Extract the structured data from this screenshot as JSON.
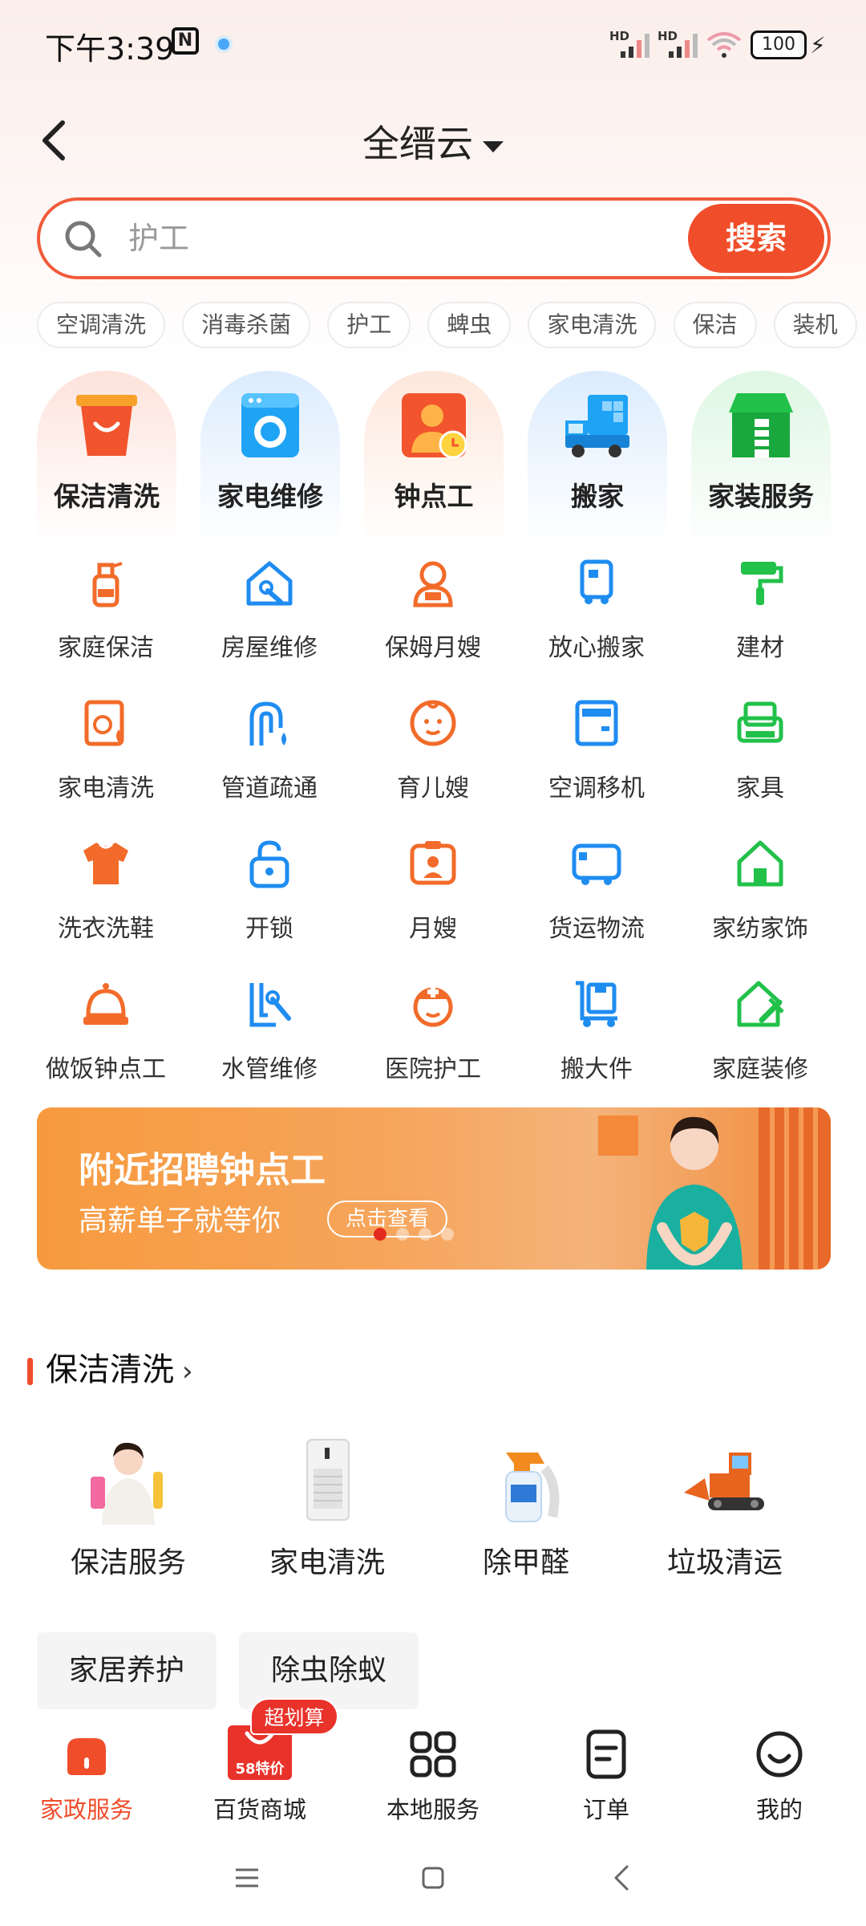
{
  "status_bar": {
    "time": "下午3:39",
    "nfc": "N",
    "hd1": "HD",
    "hd2": "HD",
    "battery": "100"
  },
  "header": {
    "city": "全缙云"
  },
  "search": {
    "placeholder": "护工",
    "button": "搜索"
  },
  "chips": [
    "空调清洗",
    "消毒杀菌",
    "护工",
    "蜱虫",
    "家电清洗",
    "保洁",
    "装机"
  ],
  "big_categories": [
    {
      "label": "保洁清洗",
      "icon": "basket-icon"
    },
    {
      "label": "家电维修",
      "icon": "washing-machine-icon"
    },
    {
      "label": "钟点工",
      "icon": "worker-clock-icon"
    },
    {
      "label": "搬家",
      "icon": "moving-truck-icon"
    },
    {
      "label": "家装服务",
      "icon": "house-ladder-icon"
    }
  ],
  "grid_items": [
    {
      "label": "家庭保洁",
      "icon": "spray-bottle-icon"
    },
    {
      "label": "房屋维修",
      "icon": "house-wrench-icon"
    },
    {
      "label": "保姆月嫂",
      "icon": "nanny-icon"
    },
    {
      "label": "放心搬家",
      "icon": "truck-icon"
    },
    {
      "label": "建材",
      "icon": "paint-roller-icon"
    },
    {
      "label": "家电清洗",
      "icon": "appliance-clean-icon"
    },
    {
      "label": "管道疏通",
      "icon": "pipe-icon"
    },
    {
      "label": "育儿嫂",
      "icon": "baby-icon"
    },
    {
      "label": "空调移机",
      "icon": "air-conditioner-icon"
    },
    {
      "label": "家具",
      "icon": "sofa-icon"
    },
    {
      "label": "洗衣洗鞋",
      "icon": "shirt-icon"
    },
    {
      "label": "开锁",
      "icon": "lock-icon"
    },
    {
      "label": "月嫂",
      "icon": "caregiver-icon"
    },
    {
      "label": "货运物流",
      "icon": "van-icon"
    },
    {
      "label": "家纺家饰",
      "icon": "home-icon"
    },
    {
      "label": "做饭钟点工",
      "icon": "cloche-icon"
    },
    {
      "label": "水管维修",
      "icon": "faucet-wrench-icon"
    },
    {
      "label": "医院护工",
      "icon": "nurse-icon"
    },
    {
      "label": "搬大件",
      "icon": "hand-truck-icon"
    },
    {
      "label": "家庭装修",
      "icon": "house-renovate-icon"
    }
  ],
  "banner": {
    "title": "附近招聘钟点工",
    "subtitle": "高薪单子就等你",
    "cta": "点击查看"
  },
  "section": {
    "title": "保洁清洗",
    "items": [
      {
        "label": "保洁服务",
        "icon": "cleaner-woman-image"
      },
      {
        "label": "家电清洗",
        "icon": "air-purifier-image"
      },
      {
        "label": "除甲醛",
        "icon": "spray-bottle-image"
      },
      {
        "label": "垃圾清运",
        "icon": "bulldozer-image"
      }
    ],
    "tags": [
      "家居养护",
      "除虫除蚁"
    ]
  },
  "tabbar": {
    "badge": "超划算",
    "mall_icon_text": "58特价",
    "tabs": [
      {
        "label": "家政服务",
        "icon": "house-service-icon"
      },
      {
        "label": "百货商城",
        "icon": "shopping-bag-icon"
      },
      {
        "label": "本地服务",
        "icon": "grid-icon"
      },
      {
        "label": "订单",
        "icon": "order-icon"
      },
      {
        "label": "我的",
        "icon": "smile-icon"
      }
    ]
  },
  "colors": {
    "accent": "#f04d2a",
    "orange_icon": "#f26b2a",
    "blue_icon": "#1f8cf0",
    "green_icon": "#22c14a"
  }
}
